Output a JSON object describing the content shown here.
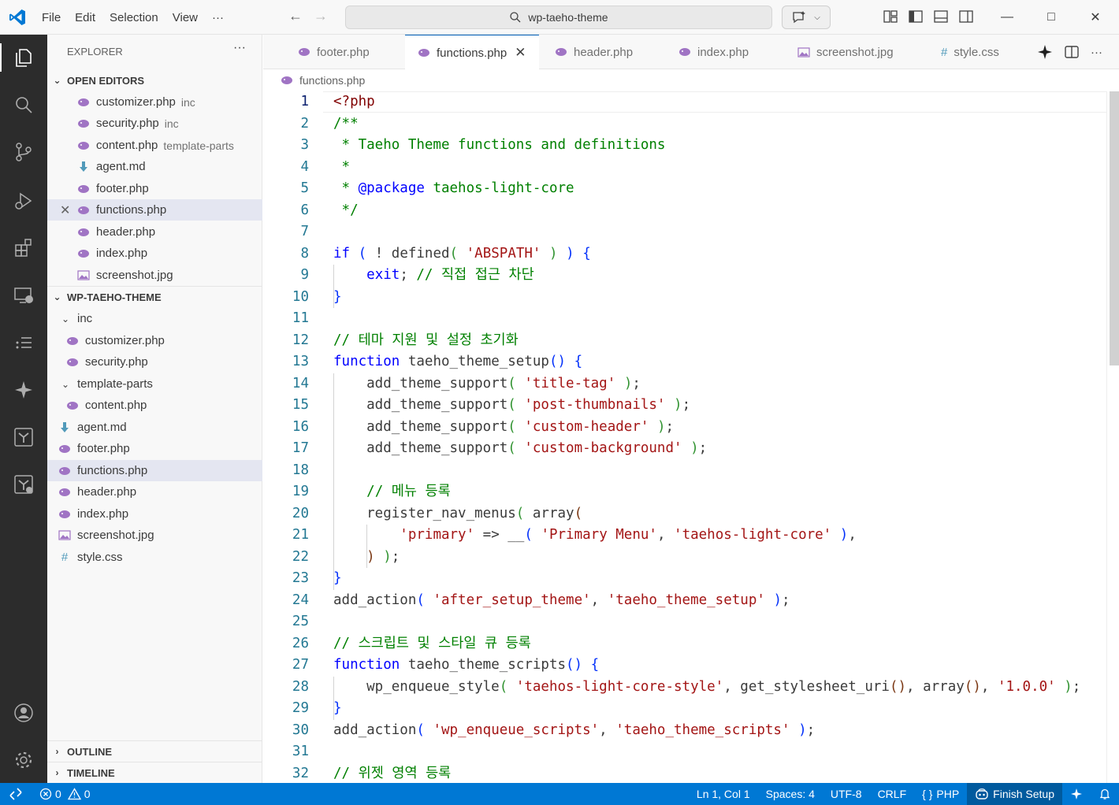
{
  "titlebar": {
    "menu": [
      "File",
      "Edit",
      "Selection",
      "View",
      "···"
    ],
    "search": "wp-taeho-theme"
  },
  "sidebar": {
    "title": "EXPLORER",
    "more": "···",
    "open_editors_label": "OPEN EDITORS",
    "open_editors": [
      {
        "name": "customizer.php",
        "desc": "inc",
        "icon": "php-icon"
      },
      {
        "name": "security.php",
        "desc": "inc",
        "icon": "php-icon"
      },
      {
        "name": "content.php",
        "desc": "template-parts",
        "icon": "php-icon"
      },
      {
        "name": "agent.md",
        "desc": "",
        "icon": "markdown-icon"
      },
      {
        "name": "footer.php",
        "desc": "",
        "icon": "php-icon"
      },
      {
        "name": "functions.php",
        "desc": "",
        "icon": "php-icon"
      },
      {
        "name": "header.php",
        "desc": "",
        "icon": "php-icon"
      },
      {
        "name": "index.php",
        "desc": "",
        "icon": "php-icon"
      },
      {
        "name": "screenshot.jpg",
        "desc": "",
        "icon": "image-icon"
      }
    ],
    "folder_label": "WP-TAEHO-THEME",
    "tree": {
      "inc": "inc",
      "customizer": "customizer.php",
      "security": "security.php",
      "template_parts": "template-parts",
      "content": "content.php",
      "agent": "agent.md",
      "footer": "footer.php",
      "functions": "functions.php",
      "header": "header.php",
      "index": "index.php",
      "screenshot": "screenshot.jpg",
      "style": "style.css"
    },
    "outline_label": "OUTLINE",
    "timeline_label": "TIMELINE"
  },
  "tabs": [
    {
      "label": "footer.php",
      "icon": "php-icon"
    },
    {
      "label": "functions.php",
      "icon": "php-icon",
      "active": true
    },
    {
      "label": "header.php",
      "icon": "php-icon"
    },
    {
      "label": "index.php",
      "icon": "php-icon"
    },
    {
      "label": "screenshot.jpg",
      "icon": "image-icon"
    },
    {
      "label": "style.css",
      "icon": "css-icon"
    }
  ],
  "breadcrumb": "functions.php",
  "editor": {
    "current_line": 1,
    "lines": [
      [
        [
          "t",
          "<?php"
        ]
      ],
      [
        [
          "c",
          "/**"
        ]
      ],
      [
        [
          "c",
          " * Taeho Theme functions and definitions"
        ]
      ],
      [
        [
          "c",
          " *"
        ]
      ],
      [
        [
          "c",
          " * "
        ],
        [
          "k",
          "@package"
        ],
        [
          "c",
          " taehos-light-core"
        ]
      ],
      [
        [
          "c",
          " */"
        ]
      ],
      [],
      [
        [
          "k",
          "if"
        ],
        [
          "p",
          " "
        ],
        [
          "b1",
          "("
        ],
        [
          "p",
          " ! "
        ],
        [
          "f",
          "defined"
        ],
        [
          "b2",
          "("
        ],
        [
          "p",
          " "
        ],
        [
          "s",
          "'ABSPATH'"
        ],
        [
          "p",
          " "
        ],
        [
          "b2",
          ")"
        ],
        [
          "p",
          " "
        ],
        [
          "b1",
          ")"
        ],
        [
          "p",
          " "
        ],
        [
          "b1",
          "{"
        ]
      ],
      [
        [
          "p",
          "    "
        ],
        [
          "k",
          "exit"
        ],
        [
          "p",
          "; "
        ],
        [
          "c",
          "// 직접 접근 차단"
        ]
      ],
      [
        [
          "b1",
          "}"
        ]
      ],
      [],
      [
        [
          "c",
          "// 테마 지원 및 설정 초기화"
        ]
      ],
      [
        [
          "k",
          "function"
        ],
        [
          "p",
          " taeho_theme_setup"
        ],
        [
          "b1",
          "()"
        ],
        [
          "p",
          " "
        ],
        [
          "b1",
          "{"
        ]
      ],
      [
        [
          "p",
          "    add_theme_support"
        ],
        [
          "b2",
          "("
        ],
        [
          "p",
          " "
        ],
        [
          "s",
          "'title-tag'"
        ],
        [
          "p",
          " "
        ],
        [
          "b2",
          ")"
        ],
        [
          "p",
          ";"
        ]
      ],
      [
        [
          "p",
          "    add_theme_support"
        ],
        [
          "b2",
          "("
        ],
        [
          "p",
          " "
        ],
        [
          "s",
          "'post-thumbnails'"
        ],
        [
          "p",
          " "
        ],
        [
          "b2",
          ")"
        ],
        [
          "p",
          ";"
        ]
      ],
      [
        [
          "p",
          "    add_theme_support"
        ],
        [
          "b2",
          "("
        ],
        [
          "p",
          " "
        ],
        [
          "s",
          "'custom-header'"
        ],
        [
          "p",
          " "
        ],
        [
          "b2",
          ")"
        ],
        [
          "p",
          ";"
        ]
      ],
      [
        [
          "p",
          "    add_theme_support"
        ],
        [
          "b2",
          "("
        ],
        [
          "p",
          " "
        ],
        [
          "s",
          "'custom-background'"
        ],
        [
          "p",
          " "
        ],
        [
          "b2",
          ")"
        ],
        [
          "p",
          ";"
        ]
      ],
      [],
      [
        [
          "p",
          "    "
        ],
        [
          "c",
          "// 메뉴 등록"
        ]
      ],
      [
        [
          "p",
          "    register_nav_menus"
        ],
        [
          "b2",
          "("
        ],
        [
          "p",
          " array"
        ],
        [
          "b3",
          "("
        ]
      ],
      [
        [
          "p",
          "        "
        ],
        [
          "s",
          "'primary'"
        ],
        [
          "p",
          " => __"
        ],
        [
          "b1",
          "("
        ],
        [
          "p",
          " "
        ],
        [
          "s",
          "'Primary Menu'"
        ],
        [
          "p",
          ", "
        ],
        [
          "s",
          "'taehos-light-core'"
        ],
        [
          "p",
          " "
        ],
        [
          "b1",
          ")"
        ],
        [
          "p",
          ","
        ]
      ],
      [
        [
          "p",
          "    "
        ],
        [
          "b3",
          ")"
        ],
        [
          "p",
          " "
        ],
        [
          "b2",
          ")"
        ],
        [
          "p",
          ";"
        ]
      ],
      [
        [
          "b1",
          "}"
        ]
      ],
      [
        [
          "p",
          "add_action"
        ],
        [
          "b1",
          "("
        ],
        [
          "p",
          " "
        ],
        [
          "s",
          "'after_setup_theme'"
        ],
        [
          "p",
          ", "
        ],
        [
          "s",
          "'taeho_theme_setup'"
        ],
        [
          "p",
          " "
        ],
        [
          "b1",
          ")"
        ],
        [
          "p",
          ";"
        ]
      ],
      [],
      [
        [
          "c",
          "// 스크립트 및 스타일 큐 등록"
        ]
      ],
      [
        [
          "k",
          "function"
        ],
        [
          "p",
          " taeho_theme_scripts"
        ],
        [
          "b1",
          "()"
        ],
        [
          "p",
          " "
        ],
        [
          "b1",
          "{"
        ]
      ],
      [
        [
          "p",
          "    wp_enqueue_style"
        ],
        [
          "b2",
          "("
        ],
        [
          "p",
          " "
        ],
        [
          "s",
          "'taehos-light-core-style'"
        ],
        [
          "p",
          ", get_stylesheet_uri"
        ],
        [
          "b3",
          "()"
        ],
        [
          "p",
          ", array"
        ],
        [
          "b3",
          "()"
        ],
        [
          "p",
          ", "
        ],
        [
          "s",
          "'1.0.0'"
        ],
        [
          "p",
          " "
        ],
        [
          "b2",
          ")"
        ],
        [
          "p",
          ";"
        ]
      ],
      [
        [
          "b1",
          "}"
        ]
      ],
      [
        [
          "p",
          "add_action"
        ],
        [
          "b1",
          "("
        ],
        [
          "p",
          " "
        ],
        [
          "s",
          "'wp_enqueue_scripts'"
        ],
        [
          "p",
          ", "
        ],
        [
          "s",
          "'taeho_theme_scripts'"
        ],
        [
          "p",
          " "
        ],
        [
          "b1",
          ")"
        ],
        [
          "p",
          ";"
        ]
      ],
      [],
      [
        [
          "c",
          "// 위젯 영역 등록"
        ]
      ]
    ]
  },
  "statusbar": {
    "errors": "0",
    "warnings": "0",
    "position": "Ln 1, Col 1",
    "spaces": "Spaces: 4",
    "encoding": "UTF-8",
    "eol": "CRLF",
    "language_braces": "{ }",
    "language": "PHP",
    "finish_setup": "Finish Setup"
  },
  "colors": {
    "accent": "#0078d4",
    "activity_bar": "#2c2c2c",
    "php_icon": "#a074c4",
    "markdown_icon": "#519aba"
  }
}
